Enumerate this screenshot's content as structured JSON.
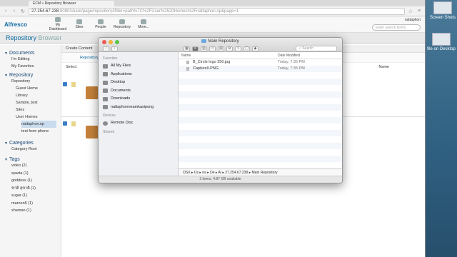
{
  "browser": {
    "tab_title": "ECM » Repository Browser",
    "url_main": "27.254.67.238",
    "url_rest": ":8080/share/page/repository#filter=path%7C%2FUser%2520Homes%2Fnattaphon.np&page=1"
  },
  "alfresco": {
    "logo": "Alfresco",
    "nav": [
      "My Dashboard",
      "Sites",
      "People",
      "Repository",
      "More..."
    ],
    "user": "nattaphon",
    "search_placeholder": "Enter search terms",
    "page_title": "Repository",
    "page_title_sub": "Browser",
    "toolbar_create": "Create Content",
    "path_label": "Repository",
    "select_label": "Select",
    "sort_label": "Name"
  },
  "sidebar": {
    "documents_header": "Documents",
    "documents_items": [
      "I'm Editing",
      "My Favorites"
    ],
    "repository_header": "Repository",
    "repository_root": "Repository",
    "repository_items": [
      "Guest Home",
      "Library",
      "Sample_test",
      "Sites",
      "User Homes"
    ],
    "user_homes_children": [
      "nattaphon.np",
      "test from phone"
    ],
    "categories_header": "Categories",
    "categories_items": [
      "Category Root"
    ],
    "tags_header": "Tags",
    "tags": [
      "video (2)",
      "sparta (1)",
      "goddess (1)",
      "ชาติ สุขาติ (1)",
      "sugar (1)",
      "maroon5 (1)",
      "shaman (1)"
    ]
  },
  "desktop": {
    "icons": [
      "Screen Shots",
      "file on Desktop"
    ]
  },
  "finder": {
    "title": "Main Repository",
    "search_placeholder": "Search",
    "favorites_header": "Favorites",
    "favorites": [
      {
        "label": "All My Files",
        "icon": "all-files-icon"
      },
      {
        "label": "Applications",
        "icon": "applications-icon"
      },
      {
        "label": "Desktop",
        "icon": "desktop-icon"
      },
      {
        "label": "Documents",
        "icon": "documents-icon"
      },
      {
        "label": "Downloads",
        "icon": "downloads-icon"
      },
      {
        "label": "nattaphonneamkasipong",
        "icon": "home-icon"
      }
    ],
    "devices_header": "Devices",
    "devices": [
      {
        "label": "Remote Disc",
        "icon": "disc-icon"
      }
    ],
    "shared_header": "Shared",
    "col_name": "Name",
    "col_date": "Date Modified",
    "files": [
      {
        "name": "B_Circle logo 250.jpg",
        "date": "Today, 7:35 PM"
      },
      {
        "name": "Capture0.PNG",
        "date": "Today, 7:35 PM"
      }
    ],
    "path": "OSX  ▸  Us  ▸  na  ▸  De  ▸  Al  ▸  27.254.67.238  ▸  Main Repository",
    "status": "2 items, 4.87 GB available",
    "colors": {
      "close": "#ee5b55",
      "minimize": "#f1b33a",
      "zoom": "#5bc64a",
      "accent": "#0b6aa2"
    }
  }
}
